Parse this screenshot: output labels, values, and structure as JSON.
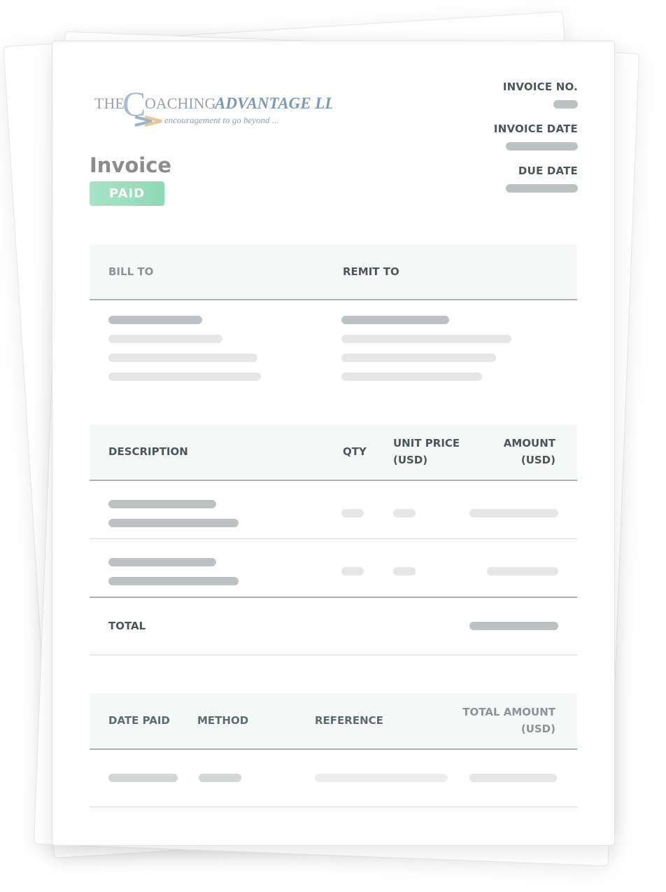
{
  "document": {
    "logo": {
      "prefix": "THE",
      "initial": "C",
      "word1": "OACHING",
      "word2": "ADVANTAGE LLC",
      "tagline": "encouragement to go beyond ..."
    },
    "title": "Invoice",
    "status_badge": "PAID",
    "status_color": "#8ed9b6",
    "meta": {
      "invoice_no_label": "INVOICE NO.",
      "invoice_date_label": "INVOICE DATE",
      "due_date_label": "DUE DATE"
    },
    "parties": {
      "bill_to_label": "BILL TO",
      "remit_to_label": "REMIT TO"
    },
    "line_items": {
      "headers": {
        "description": "DESCRIPTION",
        "qty": "QTY",
        "unit_price_line1": "UNIT PRICE",
        "unit_price_line2": "(USD)",
        "amount_line1": "AMOUNT",
        "amount_line2": "(USD)"
      },
      "row_count": 2,
      "total_label": "TOTAL"
    },
    "payments": {
      "headers": {
        "date_paid": "DATE PAID",
        "method": "METHOD",
        "reference": "REFERENCE",
        "total_amount_line1": "TOTAL AMOUNT",
        "total_amount_line2": "(USD)"
      },
      "row_count": 1
    }
  }
}
